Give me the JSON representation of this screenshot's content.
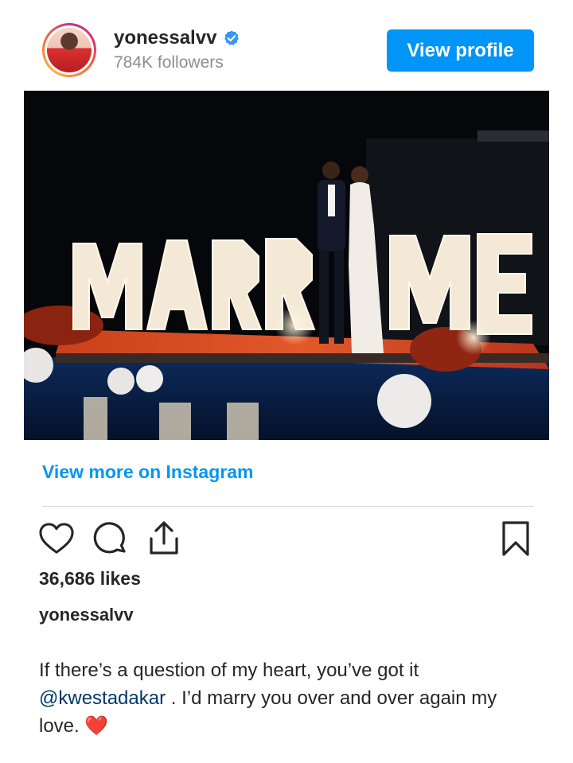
{
  "header": {
    "username": "yonessalvv",
    "followers": "784K followers",
    "view_profile_label": "View profile",
    "verified": true
  },
  "post": {
    "photo_sign_text": "MARRY ME",
    "view_more_label": "View more on Instagram",
    "likes": "36,686 likes",
    "caption_user": "yonessalvv",
    "caption_line1": "If there’s a question of my heart, you’ve got it",
    "caption_mention": "@kwestadakar",
    "caption_line2": " . I’d marry you over and over again my",
    "caption_line3": "love. ",
    "caption_emoji": "❤️"
  },
  "actions": [
    "heart-icon",
    "comment-icon",
    "share-icon",
    "bookmark-icon"
  ],
  "colors": {
    "accent": "#0095f6",
    "text": "#262626",
    "muted": "#8e8e8e",
    "mention": "#00376b"
  }
}
